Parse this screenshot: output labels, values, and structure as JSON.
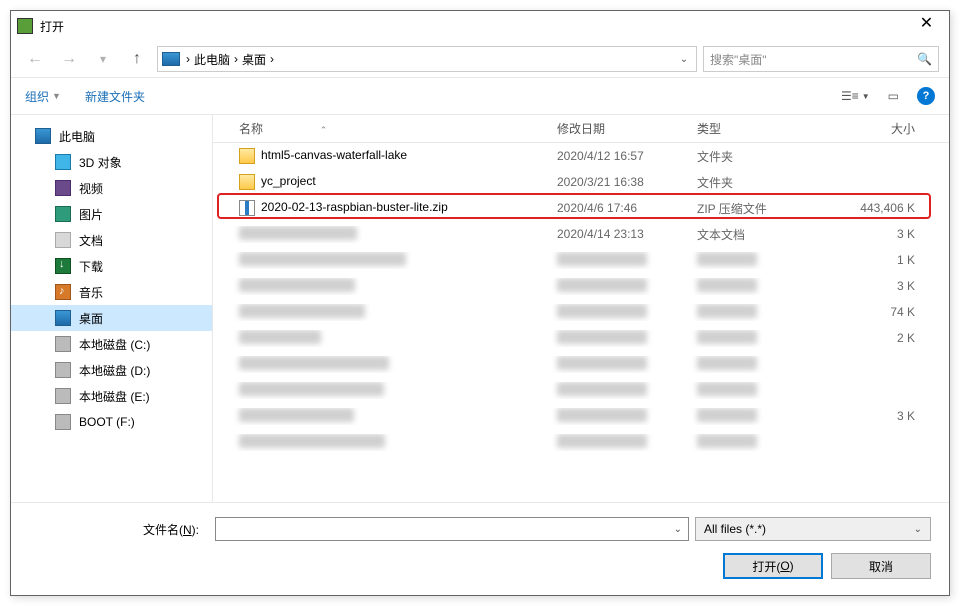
{
  "title": "打开",
  "breadcrumb": {
    "pc": "此电脑",
    "desktop": "桌面"
  },
  "search_placeholder": "搜索\"桌面\"",
  "toolbar": {
    "organize": "组织",
    "new_folder": "新建文件夹"
  },
  "sidebar": {
    "items": [
      {
        "label": "此电脑",
        "icon": "pc",
        "indent": false,
        "selected": false
      },
      {
        "label": "3D 对象",
        "icon": "3d",
        "indent": true,
        "selected": false
      },
      {
        "label": "视频",
        "icon": "video",
        "indent": true,
        "selected": false
      },
      {
        "label": "图片",
        "icon": "pic",
        "indent": true,
        "selected": false
      },
      {
        "label": "文档",
        "icon": "doc",
        "indent": true,
        "selected": false
      },
      {
        "label": "下载",
        "icon": "dl",
        "indent": true,
        "selected": false
      },
      {
        "label": "音乐",
        "icon": "music",
        "indent": true,
        "selected": false
      },
      {
        "label": "桌面",
        "icon": "desk",
        "indent": true,
        "selected": true
      },
      {
        "label": "本地磁盘 (C:)",
        "icon": "drive",
        "indent": true,
        "selected": false
      },
      {
        "label": "本地磁盘 (D:)",
        "icon": "drive",
        "indent": true,
        "selected": false
      },
      {
        "label": "本地磁盘 (E:)",
        "icon": "drive",
        "indent": true,
        "selected": false
      },
      {
        "label": "BOOT (F:)",
        "icon": "drive",
        "indent": true,
        "selected": false
      }
    ]
  },
  "columns": {
    "name": "名称",
    "date": "修改日期",
    "type": "类型",
    "size": "大小"
  },
  "files": [
    {
      "name": "html5-canvas-waterfall-lake",
      "date": "2020/4/12 16:57",
      "type": "文件夹",
      "size": "",
      "icon": "folder"
    },
    {
      "name": "yc_project",
      "date": "2020/3/21 16:38",
      "type": "文件夹",
      "size": "",
      "icon": "folder"
    },
    {
      "name": "2020-02-13-raspbian-buster-lite.zip",
      "date": "2020/4/6 17:46",
      "type": "ZIP 压缩文件",
      "size": "443,406 K",
      "icon": "zip",
      "highlighted": true
    }
  ],
  "partial_rows": [
    {
      "date": "2020/4/14 23:13",
      "type": "文本文档",
      "size": "3 K"
    },
    {
      "date": "",
      "type": "",
      "size": "1 K"
    },
    {
      "date": "",
      "type": "",
      "size": "3 K"
    },
    {
      "date": "",
      "type": "",
      "size": "74 K"
    },
    {
      "date": "",
      "type": "",
      "size": "2 K"
    },
    {
      "date": "",
      "type": "",
      "size": ""
    },
    {
      "date": "",
      "type": "",
      "size": ""
    },
    {
      "date": "",
      "type": "",
      "size": "3 K"
    },
    {
      "date": "",
      "type": "",
      "size": ""
    }
  ],
  "footer": {
    "filename_label_pre": "文件名(",
    "filename_label_u": "N",
    "filename_label_post": "):",
    "filter": "All files (*.*)",
    "open_pre": "打开(",
    "open_u": "O",
    "open_post": ")",
    "cancel": "取消"
  }
}
